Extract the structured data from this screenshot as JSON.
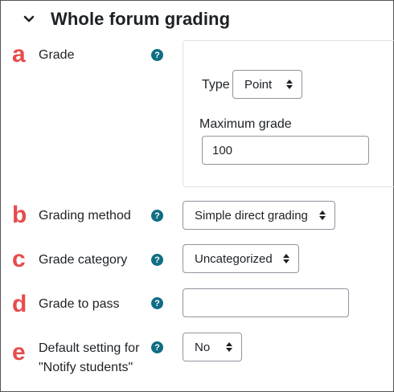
{
  "section": {
    "title": "Whole forum grading"
  },
  "badges": [
    "a",
    "b",
    "c",
    "d",
    "e"
  ],
  "fields": {
    "grade": {
      "label": "Grade",
      "help": "?",
      "type_label": "Type",
      "type_value": "Point",
      "max_label": "Maximum grade",
      "max_value": "100"
    },
    "grading_method": {
      "label": "Grading method",
      "help": "?",
      "value": "Simple direct grading"
    },
    "grade_category": {
      "label": "Grade category",
      "help": "?",
      "value": "Uncategorized"
    },
    "grade_to_pass": {
      "label": "Grade to pass",
      "help": "?",
      "value": ""
    },
    "notify_students": {
      "label_line1": "Default setting for",
      "label_line2": "\"Notify students\"",
      "help": "?",
      "value": "No"
    }
  },
  "colors": {
    "badge": "#e74c4c",
    "help_icon": "#0f6e84",
    "text": "#1d2125",
    "border": "#8f959e"
  }
}
